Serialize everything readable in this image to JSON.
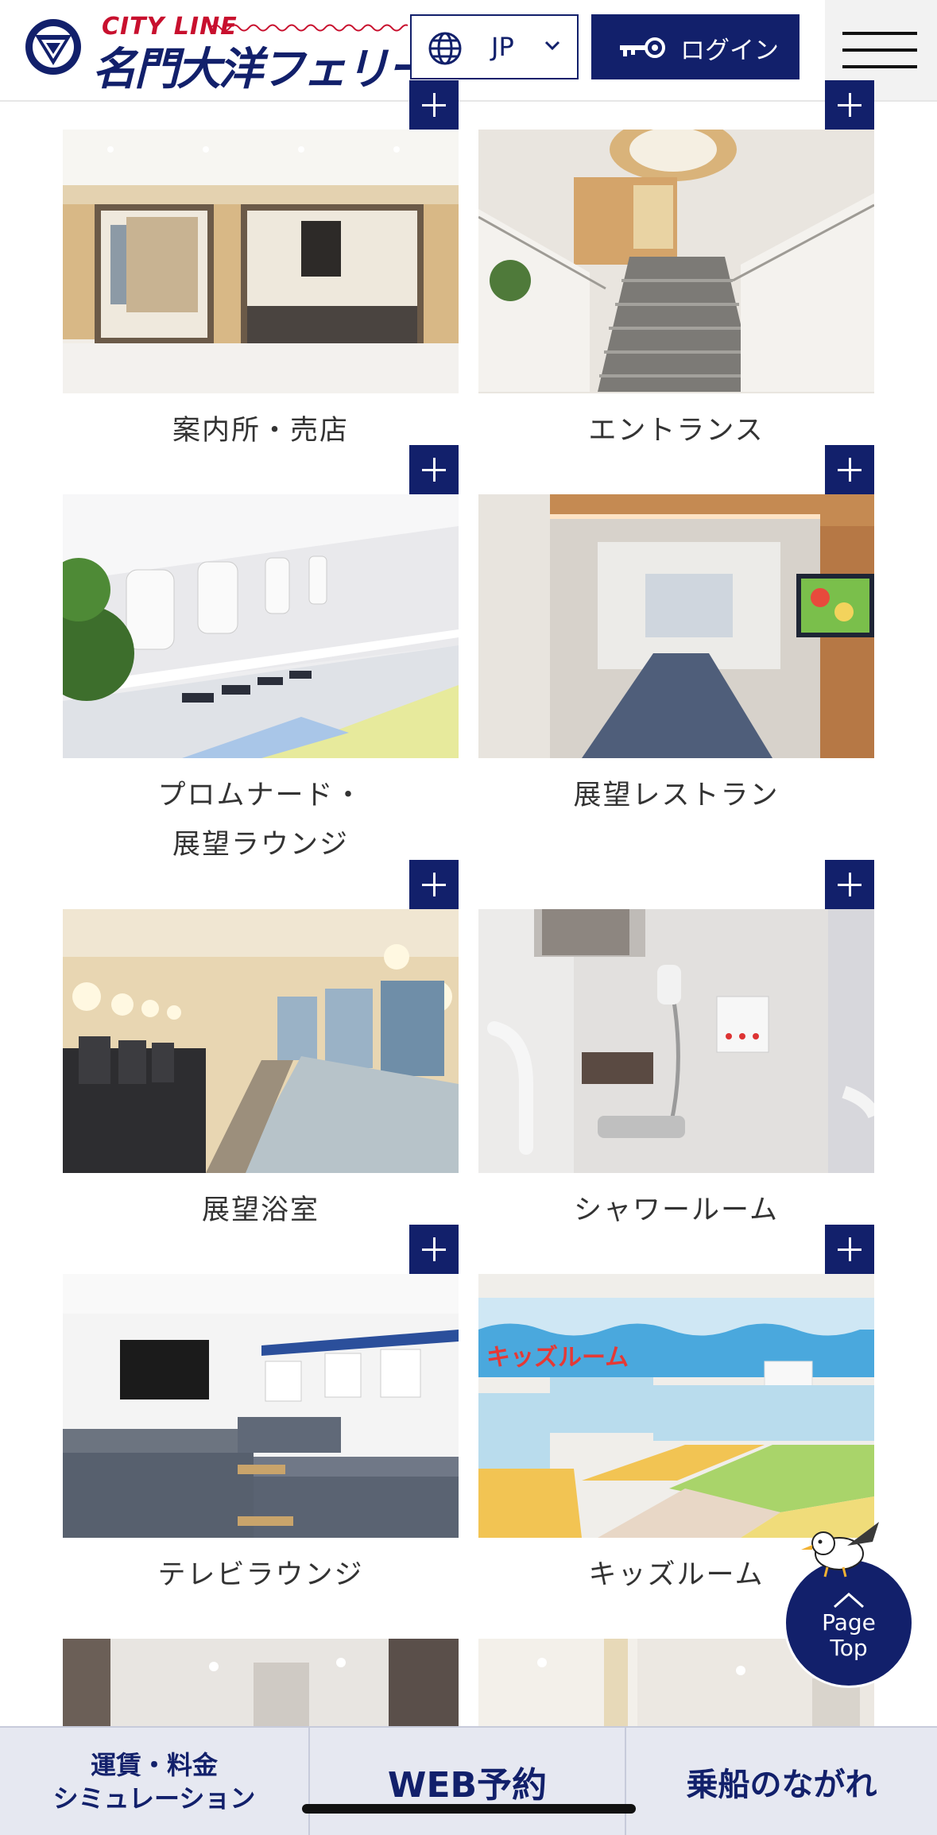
{
  "header": {
    "logo_sub": "CITY LINE",
    "logo_main": "名門大洋フェリー",
    "language_label": "JP",
    "login_label": "ログイン"
  },
  "facilities": [
    {
      "title": "案内所・売店"
    },
    {
      "title": "エントランス"
    },
    {
      "title_line1": "プロムナード・",
      "title_line2": "展望ラウンジ"
    },
    {
      "title": "展望レストラン"
    },
    {
      "title": "展望浴室"
    },
    {
      "title": "シャワールーム"
    },
    {
      "title": "テレビラウンジ"
    },
    {
      "title": "キッズルーム"
    }
  ],
  "kids_wall_text": "キッズルーム",
  "page_top": {
    "line1": "Page",
    "line2": "Top"
  },
  "bottom_nav": {
    "fare_line1": "運賃・料金",
    "fare_line2": "シミュレーション",
    "web_booking": "WEB予約",
    "boarding_flow": "乗船のながれ"
  },
  "colors": {
    "navy": "#12206b",
    "logo_red": "#c8102e",
    "bottom_bar_bg": "#e6e8f1"
  },
  "icons": [
    "globe-icon",
    "chevron-down-icon",
    "key-icon",
    "hamburger-menu-icon",
    "plus-icon",
    "seagull-icon",
    "arrow-up-icon"
  ]
}
